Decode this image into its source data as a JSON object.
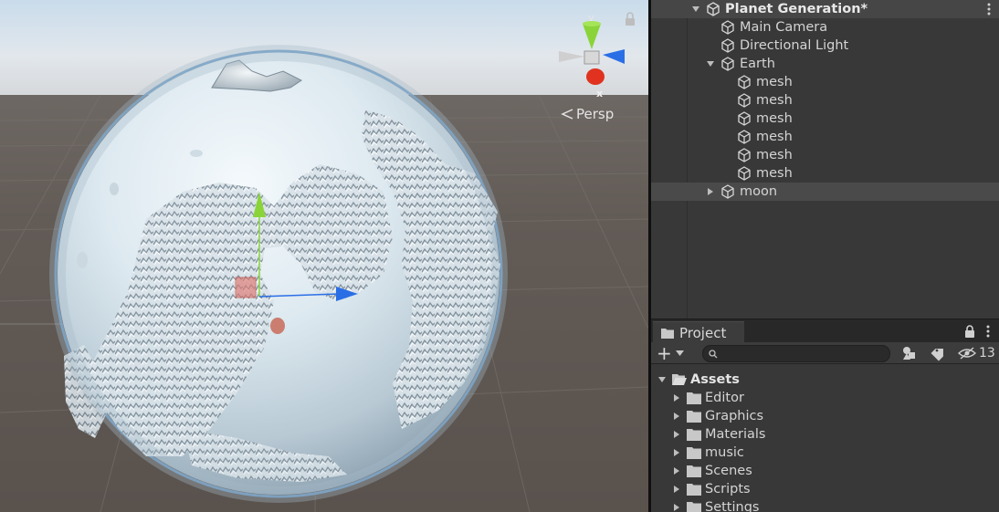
{
  "scene_view": {
    "projection_label": "Persp",
    "gizmo_axes": {
      "y": "y",
      "x": "x"
    }
  },
  "hierarchy": {
    "scene_name": "Planet Generation*",
    "items": [
      {
        "label": "Main Camera",
        "depth": 1,
        "expandable": false
      },
      {
        "label": "Directional Light",
        "depth": 1,
        "expandable": false
      },
      {
        "label": "Earth",
        "depth": 1,
        "expandable": true,
        "expanded": true
      },
      {
        "label": "mesh",
        "depth": 2,
        "expandable": false
      },
      {
        "label": "mesh",
        "depth": 2,
        "expandable": false
      },
      {
        "label": "mesh",
        "depth": 2,
        "expandable": false
      },
      {
        "label": "mesh",
        "depth": 2,
        "expandable": false
      },
      {
        "label": "mesh",
        "depth": 2,
        "expandable": false
      },
      {
        "label": "mesh",
        "depth": 2,
        "expandable": false
      },
      {
        "label": "moon",
        "depth": 1,
        "expandable": true,
        "expanded": false
      }
    ]
  },
  "project": {
    "tab_label": "Project",
    "add_label": "+",
    "search_placeholder": "",
    "hidden_count": "13",
    "root": "Assets",
    "folders": [
      "Editor",
      "Graphics",
      "Materials",
      "music",
      "Scenes",
      "Scripts",
      "Settings"
    ]
  },
  "colors": {
    "panel_bg": "#383838",
    "selected_row": "#4a4a4a",
    "gizmo_y": "#8ad43a",
    "gizmo_x": "#e0321e",
    "gizmo_z": "#2a6ee6"
  }
}
